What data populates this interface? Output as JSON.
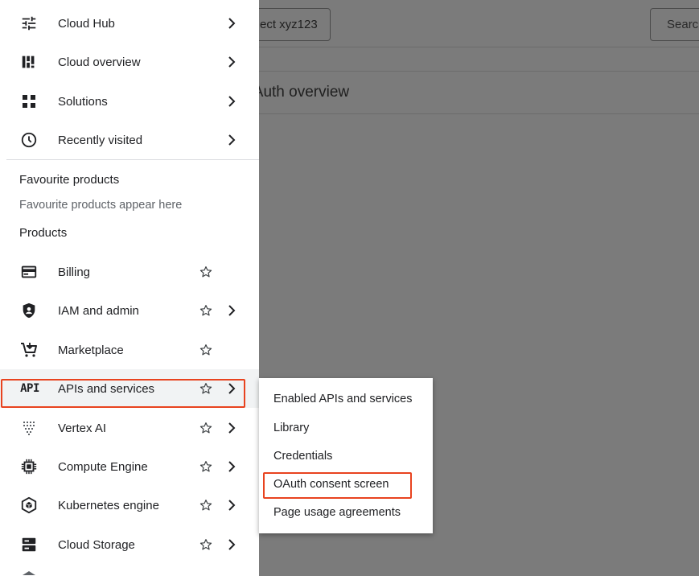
{
  "background": {
    "project_button_text": "ect xyz123",
    "search_text": "Searc",
    "page_title": "OAuth overview"
  },
  "nav": {
    "top_items": [
      {
        "label": "Cloud Hub",
        "icon": "tune-icon"
      },
      {
        "label": "Cloud overview",
        "icon": "dashboard-icon"
      },
      {
        "label": "Solutions",
        "icon": "grid-icon"
      },
      {
        "label": "Recently visited",
        "icon": "clock-icon"
      }
    ],
    "favourites": {
      "title": "Favourite products",
      "hint": "Favourite products appear here"
    },
    "products_title": "Products",
    "products": [
      {
        "label": "Billing",
        "icon": "billing-icon",
        "submenu": false
      },
      {
        "label": "IAM and admin",
        "icon": "shield-person-icon",
        "submenu": true
      },
      {
        "label": "Marketplace",
        "icon": "cart-icon",
        "submenu": false
      },
      {
        "label": "APIs and services",
        "icon": "api-icon",
        "submenu": true
      },
      {
        "label": "Vertex AI",
        "icon": "vertex-ai-icon",
        "submenu": true
      },
      {
        "label": "Compute Engine",
        "icon": "chip-icon",
        "submenu": true
      },
      {
        "label": "Kubernetes engine",
        "icon": "kubernetes-icon",
        "submenu": true
      },
      {
        "label": "Cloud Storage",
        "icon": "storage-icon",
        "submenu": true
      }
    ],
    "api_icon_text": "API"
  },
  "submenu": {
    "items": [
      "Enabled APIs and services",
      "Library",
      "Credentials",
      "OAuth consent screen",
      "Page usage agreements"
    ]
  },
  "colors": {
    "highlight": "#e8431f",
    "overlay": "#7b7b7b",
    "active_row": "#f1f3f4"
  }
}
